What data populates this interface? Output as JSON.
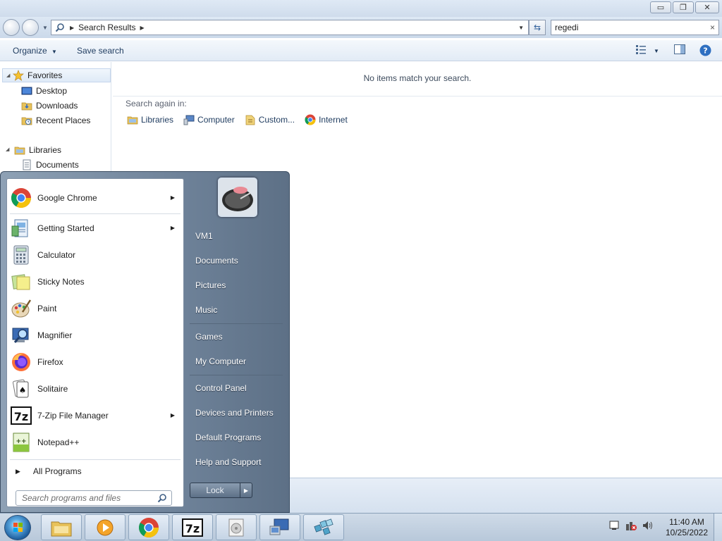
{
  "window": {
    "minimize_glyph": "▭",
    "restore_glyph": "❐",
    "close_glyph": "✕"
  },
  "navigation": {
    "address_path": "Search Results",
    "search_value": "regedi",
    "search_clear": "×"
  },
  "toolbar": {
    "organize_label": "Organize",
    "save_search_label": "Save search"
  },
  "nav_pane": {
    "favorites_label": "Favorites",
    "desktop_label": "Desktop",
    "downloads_label": "Downloads",
    "recent_places_label": "Recent Places",
    "libraries_label": "Libraries",
    "documents_label": "Documents"
  },
  "content": {
    "no_items_text": "No items match your search.",
    "search_again_label": "Search again in:",
    "locations": [
      "Libraries",
      "Computer",
      "Custom...",
      "Internet"
    ]
  },
  "start_menu": {
    "programs": [
      {
        "label": "Google Chrome",
        "icon": "chrome-icon",
        "has_arrow": true
      },
      {
        "label": "Getting Started",
        "icon": "getting-started-icon",
        "has_arrow": true
      },
      {
        "label": "Calculator",
        "icon": "calculator-icon",
        "has_arrow": false
      },
      {
        "label": "Sticky Notes",
        "icon": "sticky-notes-icon",
        "has_arrow": false
      },
      {
        "label": "Paint",
        "icon": "paint-icon",
        "has_arrow": false
      },
      {
        "label": "Magnifier",
        "icon": "magnifier-icon",
        "has_arrow": false
      },
      {
        "label": "Firefox",
        "icon": "firefox-icon",
        "has_arrow": false
      },
      {
        "label": "Solitaire",
        "icon": "solitaire-icon",
        "has_arrow": false
      },
      {
        "label": "7-Zip File Manager",
        "icon": "seven-zip-icon",
        "has_arrow": true
      },
      {
        "label": "Notepad++",
        "icon": "notepad-plus-plus-icon",
        "has_arrow": false
      }
    ],
    "all_programs_label": "All Programs",
    "search_placeholder": "Search programs and files",
    "right_items": [
      "VM1",
      "Documents",
      "Pictures",
      "Music",
      "Games",
      "My Computer",
      "Control Panel",
      "Devices and Printers",
      "Default Programs",
      "Help and Support"
    ],
    "lock_label": "Lock"
  },
  "taskbar": {
    "pinned": [
      "explorer-icon",
      "media-player-icon",
      "chrome-icon",
      "seven-zip-icon",
      "disc-icon",
      "remote-desktop-icon",
      "registry-editor-icon"
    ],
    "time": "11:40 AM",
    "date": "10/25/2022"
  },
  "colors": {
    "accent_blue": "#1e3b5f",
    "start_menu_right": "#6f839a",
    "taskbar": "#c5d4e5"
  }
}
